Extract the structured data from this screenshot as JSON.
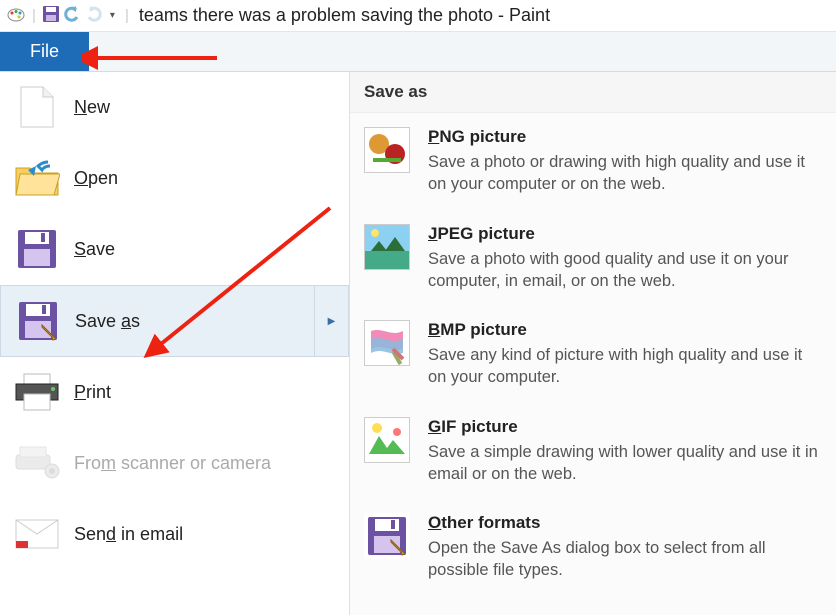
{
  "window": {
    "title": "teams there was a problem saving the photo - Paint"
  },
  "tabs": {
    "file": "File"
  },
  "menu": {
    "new": "New",
    "open": "Open",
    "save": "Save",
    "saveas": "Save as",
    "print": "Print",
    "scanner": "From scanner or camera",
    "email": "Send in email"
  },
  "right": {
    "header": "Save as",
    "items": [
      {
        "title": "PNG picture",
        "u": "P",
        "rest": "NG picture",
        "desc": "Save a photo or drawing with high quality and use it on your computer or on the web."
      },
      {
        "title": "JPEG picture",
        "u": "J",
        "rest": "PEG picture",
        "desc": "Save a photo with good quality and use it on your computer, in email, or on the web."
      },
      {
        "title": "BMP picture",
        "u": "B",
        "rest": "MP picture",
        "desc": "Save any kind of picture with high quality and use it on your computer."
      },
      {
        "title": "GIF picture",
        "u": "G",
        "rest": "IF picture",
        "desc": "Save a simple drawing with lower quality and use it in email or on the web."
      },
      {
        "title": "Other formats",
        "u": "O",
        "rest": "ther formats",
        "desc": "Open the Save As dialog box to select from all possible file types."
      }
    ]
  }
}
